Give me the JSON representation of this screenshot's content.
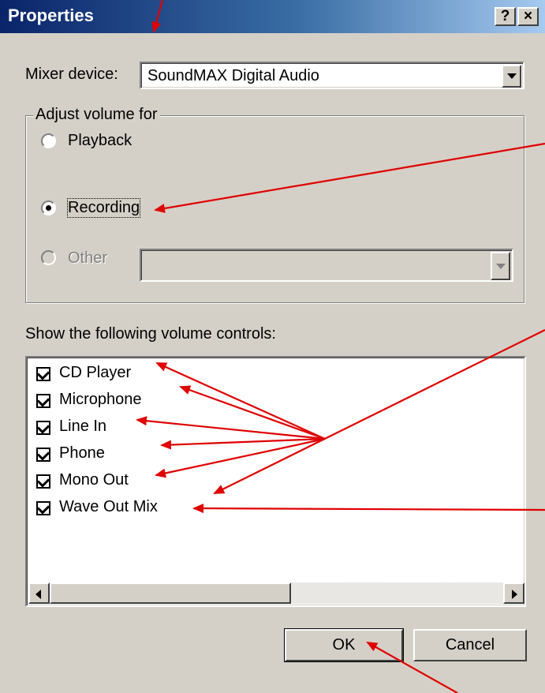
{
  "window": {
    "title": "Properties",
    "help_button": "?",
    "close_button": "×"
  },
  "mixer_device": {
    "label": "Mixer device:",
    "value": "SoundMAX Digital Audio"
  },
  "adjust_volume": {
    "group_label": "Adjust volume for",
    "options": [
      {
        "label": "Playback",
        "selected": false,
        "enabled": true
      },
      {
        "label": "Recording",
        "selected": true,
        "enabled": true
      },
      {
        "label": "Other",
        "selected": false,
        "enabled": false
      }
    ]
  },
  "volume_controls": {
    "label": "Show the following volume controls:",
    "items": [
      {
        "label": "CD Player",
        "checked": true
      },
      {
        "label": "Microphone",
        "checked": true
      },
      {
        "label": "Line In",
        "checked": true
      },
      {
        "label": "Phone",
        "checked": true
      },
      {
        "label": "Mono Out",
        "checked": true
      },
      {
        "label": "Wave Out Mix",
        "checked": true
      }
    ]
  },
  "buttons": {
    "ok": "OK",
    "cancel": "Cancel"
  },
  "colors": {
    "annotation_arrows": "#e00000",
    "titlebar_start": "#0a246a",
    "titlebar_end": "#a6caf0"
  }
}
